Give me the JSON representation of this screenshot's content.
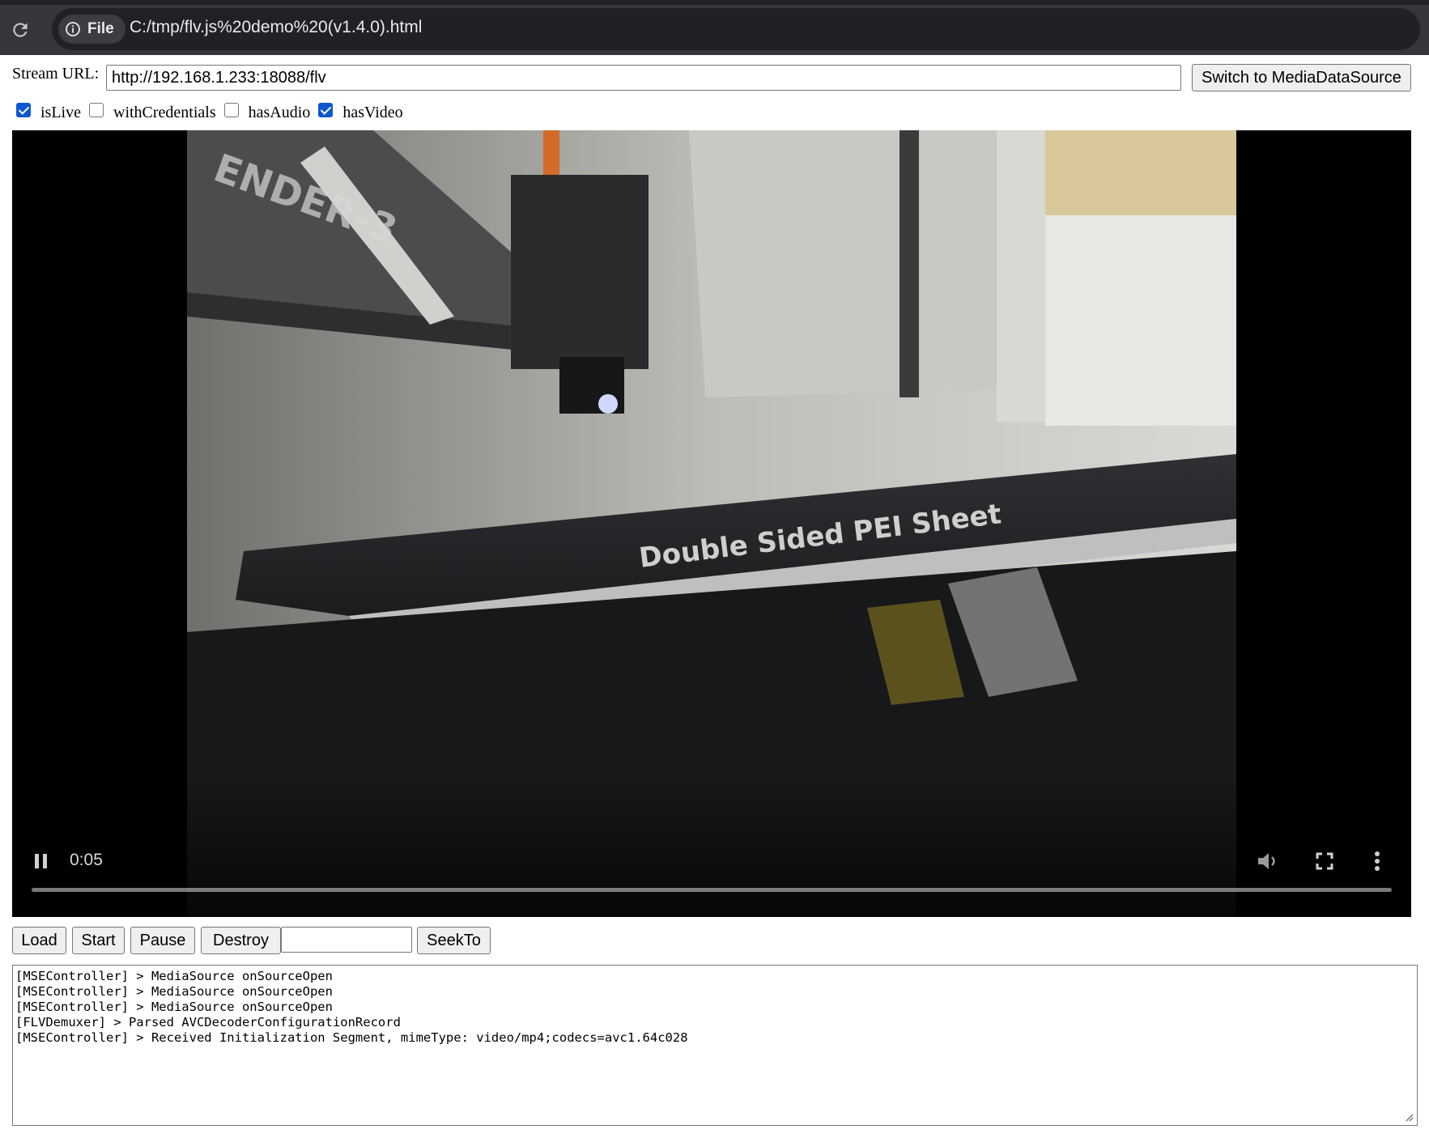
{
  "browser": {
    "scheme_chip": "File",
    "address": "C:/tmp/flv.js%20demo%20(v1.4.0).html"
  },
  "form": {
    "stream_label": "Stream URL:",
    "stream_url": "http://192.168.1.233:18088/flv",
    "switch_button": "Switch to MediaDataSource",
    "options": [
      {
        "label": "isLive",
        "checked": true
      },
      {
        "label": "withCredentials",
        "checked": false
      },
      {
        "label": "hasAudio",
        "checked": false
      },
      {
        "label": "hasVideo",
        "checked": true
      }
    ]
  },
  "video": {
    "current_time": "0:05",
    "overlay_text": "Double Sided PEI Sheet",
    "frame_text": "ENDER-3"
  },
  "controls": {
    "load": "Load",
    "start": "Start",
    "pause": "Pause",
    "destroy": "Destroy",
    "seek_value": "",
    "seekto": "SeekTo"
  },
  "log": [
    "[MSEController] > MediaSource onSourceOpen",
    "[MSEController] > MediaSource onSourceOpen",
    "[MSEController] > MediaSource onSourceOpen",
    "[FLVDemuxer] > Parsed AVCDecoderConfigurationRecord",
    "[MSEController] > Received Initialization Segment, mimeType: video/mp4;codecs=avc1.64c028"
  ],
  "colors": {
    "accent_checkbox": "#0b57d0",
    "browser_bar": "#35363a"
  }
}
